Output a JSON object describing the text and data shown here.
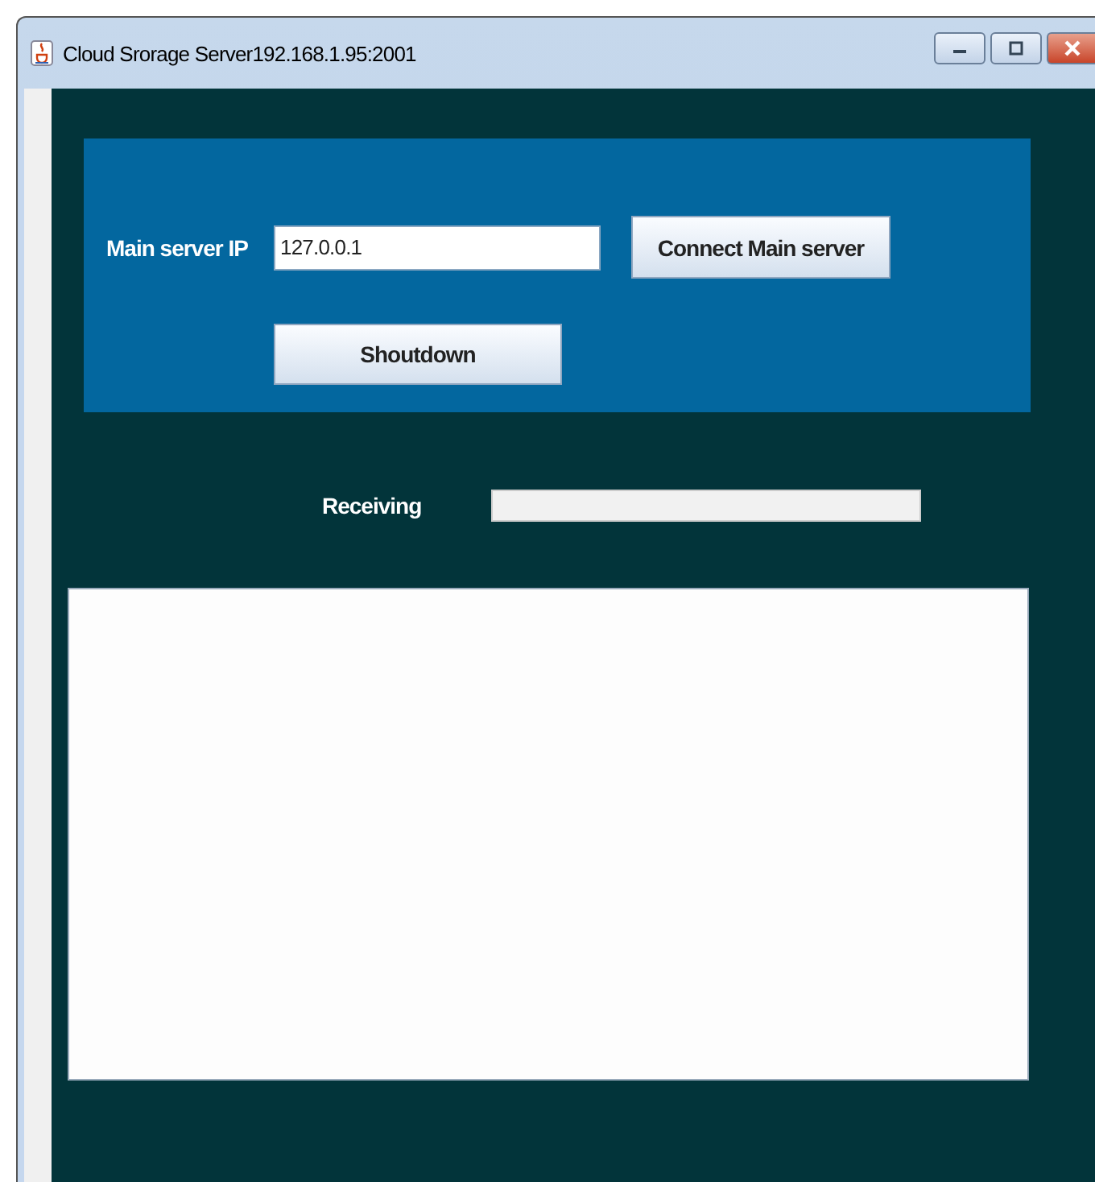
{
  "window": {
    "title": "Cloud Srorage Server192.168.1.95:2001"
  },
  "connection": {
    "label": "Main server IP",
    "ip_value": "127.0.0.1",
    "connect_button": "Connect Main server",
    "shutdown_button": "Shoutdown"
  },
  "receiving": {
    "label": "Receiving",
    "level": 0
  }
}
